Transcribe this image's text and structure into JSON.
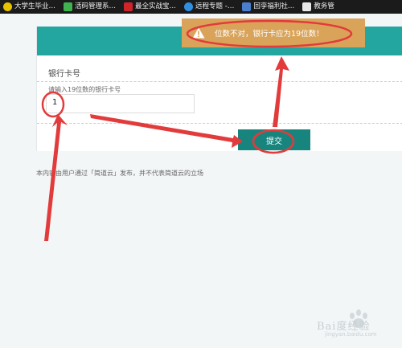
{
  "tabs": [
    {
      "label": "大学生毕业…",
      "icon": "campus-logo-icon",
      "color": "#e6c200"
    },
    {
      "label": "活码管理系…",
      "icon": "qr-grid-icon",
      "color": "#3fb34f"
    },
    {
      "label": "最全实战宝…",
      "icon": "red-badge-icon",
      "color": "#d0242b"
    },
    {
      "label": "远程专题 -…",
      "icon": "cloud-icon",
      "color": "#2f8fe0"
    },
    {
      "label": "回孪福利社…",
      "icon": "house-icon",
      "color": "#4a7fd0"
    },
    {
      "label": "教务管",
      "icon": "document-icon",
      "color": "#e8e8e8"
    }
  ],
  "form": {
    "field_label": "银行卡号",
    "hint": "请输入19位数的银行卡号",
    "input_value": "1",
    "submit_label": "提交"
  },
  "toast": {
    "message": "位数不对，银行卡应为19位数！",
    "icon": "warning-icon"
  },
  "footer_note": "本内容由用户通过「简道云」发布，并不代表简道云的立场",
  "watermark": {
    "brand": "Bai度经验",
    "url": "jingyan.baidu.com"
  },
  "colors": {
    "header": "#23a6a0",
    "submit": "#17847e",
    "toast": "#d9a35a",
    "annotation": "#e23b3b"
  }
}
